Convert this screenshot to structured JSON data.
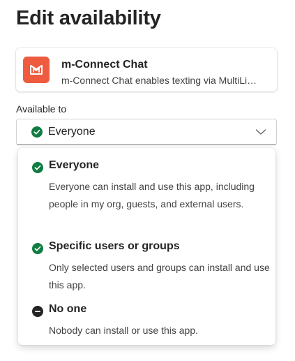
{
  "page": {
    "title": "Edit availability"
  },
  "app": {
    "name": "m-Connect Chat",
    "description": "m-Connect Chat enables texting via MultiLi…",
    "icon": "m-connect-logo-icon",
    "icon_color": "#ee5b3f"
  },
  "availability": {
    "label": "Available to",
    "selected": "Everyone",
    "selected_icon": "check-circle-icon",
    "accent_color": "#107c41",
    "options": [
      {
        "title": "Everyone",
        "description": "Everyone can install and use this app, including people in my org, guests, and external users.",
        "icon": "check-circle-icon"
      },
      {
        "title": "Specific users or groups",
        "description": "Only selected users and groups can install and use this app.",
        "icon": "check-circle-icon"
      },
      {
        "title": "No one",
        "description": "Nobody can install or use this app.",
        "icon": "minus-circle-icon"
      }
    ]
  }
}
